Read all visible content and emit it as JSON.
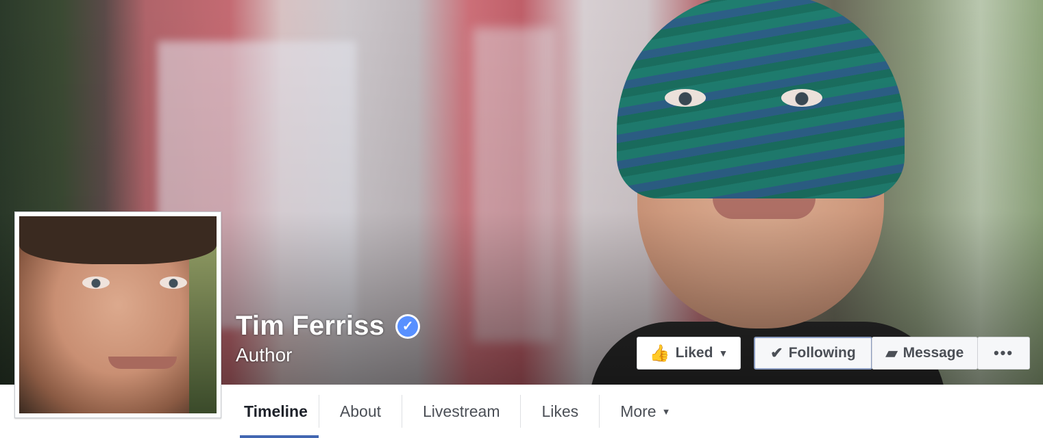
{
  "page": {
    "name": "Tim Ferriss",
    "category": "Author",
    "verified_icon": "verified-badge-icon"
  },
  "actions": {
    "liked_label": "Liked",
    "following_label": "Following",
    "message_label": "Message",
    "more_label": "•••"
  },
  "nav": {
    "tabs": [
      {
        "label": "Timeline",
        "active": true
      },
      {
        "label": "About"
      },
      {
        "label": "Livestream"
      },
      {
        "label": "Likes"
      },
      {
        "label": "More"
      }
    ]
  },
  "colors": {
    "accent": "#4267b2",
    "verified": "#5890ff"
  }
}
